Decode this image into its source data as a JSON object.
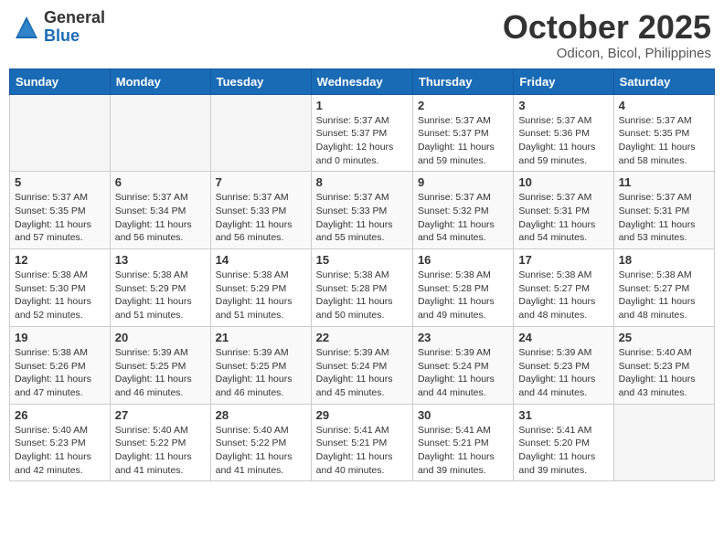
{
  "header": {
    "logo_general": "General",
    "logo_blue": "Blue",
    "month_title": "October 2025",
    "location": "Odicon, Bicol, Philippines"
  },
  "weekdays": [
    "Sunday",
    "Monday",
    "Tuesday",
    "Wednesday",
    "Thursday",
    "Friday",
    "Saturday"
  ],
  "weeks": [
    [
      {
        "day": "",
        "info": ""
      },
      {
        "day": "",
        "info": ""
      },
      {
        "day": "",
        "info": ""
      },
      {
        "day": "1",
        "info": "Sunrise: 5:37 AM\nSunset: 5:37 PM\nDaylight: 12 hours\nand 0 minutes."
      },
      {
        "day": "2",
        "info": "Sunrise: 5:37 AM\nSunset: 5:37 PM\nDaylight: 11 hours\nand 59 minutes."
      },
      {
        "day": "3",
        "info": "Sunrise: 5:37 AM\nSunset: 5:36 PM\nDaylight: 11 hours\nand 59 minutes."
      },
      {
        "day": "4",
        "info": "Sunrise: 5:37 AM\nSunset: 5:35 PM\nDaylight: 11 hours\nand 58 minutes."
      }
    ],
    [
      {
        "day": "5",
        "info": "Sunrise: 5:37 AM\nSunset: 5:35 PM\nDaylight: 11 hours\nand 57 minutes."
      },
      {
        "day": "6",
        "info": "Sunrise: 5:37 AM\nSunset: 5:34 PM\nDaylight: 11 hours\nand 56 minutes."
      },
      {
        "day": "7",
        "info": "Sunrise: 5:37 AM\nSunset: 5:33 PM\nDaylight: 11 hours\nand 56 minutes."
      },
      {
        "day": "8",
        "info": "Sunrise: 5:37 AM\nSunset: 5:33 PM\nDaylight: 11 hours\nand 55 minutes."
      },
      {
        "day": "9",
        "info": "Sunrise: 5:37 AM\nSunset: 5:32 PM\nDaylight: 11 hours\nand 54 minutes."
      },
      {
        "day": "10",
        "info": "Sunrise: 5:37 AM\nSunset: 5:31 PM\nDaylight: 11 hours\nand 54 minutes."
      },
      {
        "day": "11",
        "info": "Sunrise: 5:37 AM\nSunset: 5:31 PM\nDaylight: 11 hours\nand 53 minutes."
      }
    ],
    [
      {
        "day": "12",
        "info": "Sunrise: 5:38 AM\nSunset: 5:30 PM\nDaylight: 11 hours\nand 52 minutes."
      },
      {
        "day": "13",
        "info": "Sunrise: 5:38 AM\nSunset: 5:29 PM\nDaylight: 11 hours\nand 51 minutes."
      },
      {
        "day": "14",
        "info": "Sunrise: 5:38 AM\nSunset: 5:29 PM\nDaylight: 11 hours\nand 51 minutes."
      },
      {
        "day": "15",
        "info": "Sunrise: 5:38 AM\nSunset: 5:28 PM\nDaylight: 11 hours\nand 50 minutes."
      },
      {
        "day": "16",
        "info": "Sunrise: 5:38 AM\nSunset: 5:28 PM\nDaylight: 11 hours\nand 49 minutes."
      },
      {
        "day": "17",
        "info": "Sunrise: 5:38 AM\nSunset: 5:27 PM\nDaylight: 11 hours\nand 48 minutes."
      },
      {
        "day": "18",
        "info": "Sunrise: 5:38 AM\nSunset: 5:27 PM\nDaylight: 11 hours\nand 48 minutes."
      }
    ],
    [
      {
        "day": "19",
        "info": "Sunrise: 5:38 AM\nSunset: 5:26 PM\nDaylight: 11 hours\nand 47 minutes."
      },
      {
        "day": "20",
        "info": "Sunrise: 5:39 AM\nSunset: 5:25 PM\nDaylight: 11 hours\nand 46 minutes."
      },
      {
        "day": "21",
        "info": "Sunrise: 5:39 AM\nSunset: 5:25 PM\nDaylight: 11 hours\nand 46 minutes."
      },
      {
        "day": "22",
        "info": "Sunrise: 5:39 AM\nSunset: 5:24 PM\nDaylight: 11 hours\nand 45 minutes."
      },
      {
        "day": "23",
        "info": "Sunrise: 5:39 AM\nSunset: 5:24 PM\nDaylight: 11 hours\nand 44 minutes."
      },
      {
        "day": "24",
        "info": "Sunrise: 5:39 AM\nSunset: 5:23 PM\nDaylight: 11 hours\nand 44 minutes."
      },
      {
        "day": "25",
        "info": "Sunrise: 5:40 AM\nSunset: 5:23 PM\nDaylight: 11 hours\nand 43 minutes."
      }
    ],
    [
      {
        "day": "26",
        "info": "Sunrise: 5:40 AM\nSunset: 5:23 PM\nDaylight: 11 hours\nand 42 minutes."
      },
      {
        "day": "27",
        "info": "Sunrise: 5:40 AM\nSunset: 5:22 PM\nDaylight: 11 hours\nand 41 minutes."
      },
      {
        "day": "28",
        "info": "Sunrise: 5:40 AM\nSunset: 5:22 PM\nDaylight: 11 hours\nand 41 minutes."
      },
      {
        "day": "29",
        "info": "Sunrise: 5:41 AM\nSunset: 5:21 PM\nDaylight: 11 hours\nand 40 minutes."
      },
      {
        "day": "30",
        "info": "Sunrise: 5:41 AM\nSunset: 5:21 PM\nDaylight: 11 hours\nand 39 minutes."
      },
      {
        "day": "31",
        "info": "Sunrise: 5:41 AM\nSunset: 5:20 PM\nDaylight: 11 hours\nand 39 minutes."
      },
      {
        "day": "",
        "info": ""
      }
    ]
  ]
}
